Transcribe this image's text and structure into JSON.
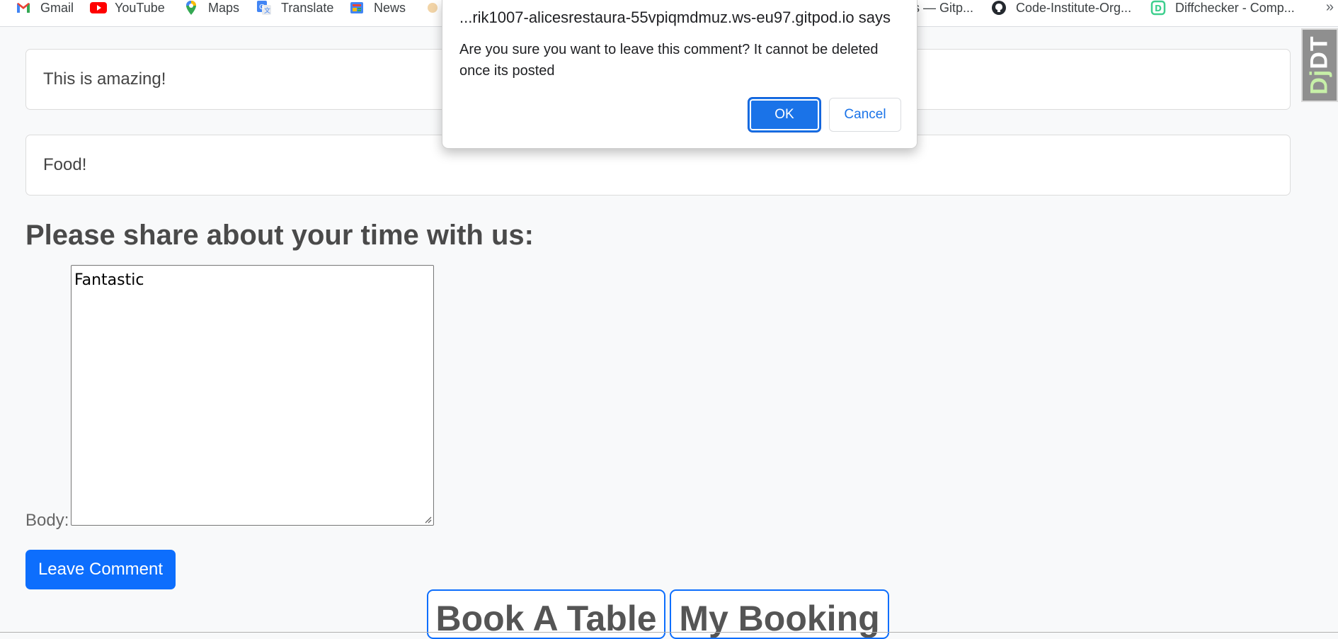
{
  "bookmarks": {
    "items": [
      {
        "label": "Gmail",
        "icon": "gmail-icon"
      },
      {
        "label": "YouTube",
        "icon": "youtube-icon"
      },
      {
        "label": "Maps",
        "icon": "maps-icon"
      },
      {
        "label": "Translate",
        "icon": "translate-icon"
      },
      {
        "label": "News",
        "icon": "news-icon"
      },
      {
        "label": "s — Gitp...",
        "icon": ""
      },
      {
        "label": "Code-Institute-Org...",
        "icon": "github-icon"
      },
      {
        "label": "Diffchecker - Comp...",
        "icon": "diffchecker-icon"
      }
    ],
    "more": "»"
  },
  "comments": [
    {
      "body": "This is amazing!"
    },
    {
      "body": "Food!"
    }
  ],
  "form": {
    "heading": "Please share about your time with us:",
    "body_label": "Body:",
    "body_value": "Fantastic",
    "submit_label": "Leave Comment"
  },
  "nav": {
    "book_label": "Book A Table",
    "my_booking_label": "My Booking"
  },
  "toolbar": {
    "dj": "Dj",
    "dt": "DT"
  },
  "dialog": {
    "title": "...rik1007-alicesrestaura-55vpiqmdmuz.ws-eu97.gitpod.io says",
    "message": "Are you sure you want to leave this comment? It cannot be deleted once its posted",
    "ok_label": "OK",
    "cancel_label": "Cancel"
  },
  "colors": {
    "page_bg": "#f8f9fa",
    "primary": "#0d6efd",
    "dialog_ok": "#1a73e8"
  }
}
